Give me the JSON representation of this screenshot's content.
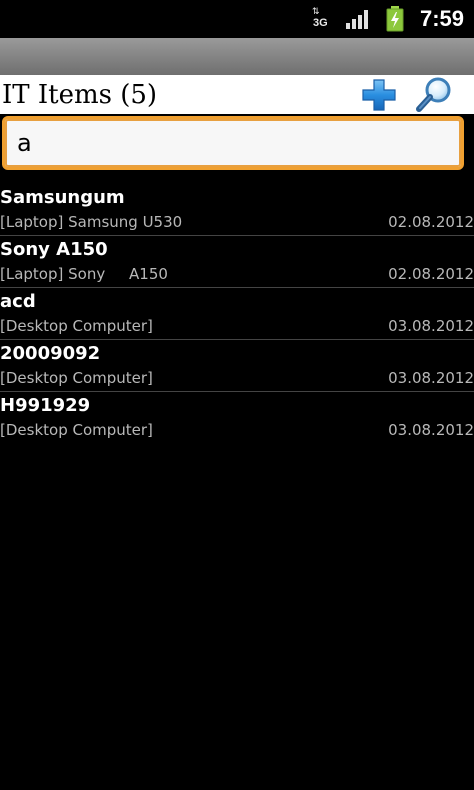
{
  "status_bar": {
    "network_type": "3G",
    "network_arrows": "⇅",
    "time": "7:59"
  },
  "header": {
    "title": "IT Items (5)",
    "add_icon": "plus-icon",
    "search_icon": "magnifier-icon"
  },
  "search": {
    "value": "a",
    "border_color": "#f0a030"
  },
  "items": [
    {
      "name": "Samsungum",
      "description": "[Laptop] Samsung U530",
      "date": "02.08.2012"
    },
    {
      "name": "Sony A150",
      "description": "[Laptop] Sony     A150",
      "date": "02.08.2012"
    },
    {
      "name": "acd",
      "description": "[Desktop Computer]",
      "date": "03.08.2012"
    },
    {
      "name": "20009092",
      "description": "[Desktop Computer]",
      "date": "03.08.2012"
    },
    {
      "name": "H991929",
      "description": "[Desktop Computer]",
      "date": "03.08.2012"
    }
  ]
}
